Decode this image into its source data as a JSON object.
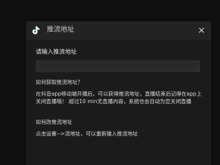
{
  "dialog": {
    "title": "推流地址",
    "app_icon": "tiktok-logo-icon",
    "close_icon": "close-icon",
    "colors": {
      "background": "#1b1b1b",
      "titlebar": "#232323",
      "input": "#2a2a2a",
      "text": "#dcdcdc"
    }
  },
  "form": {
    "label": "请输入推流地址",
    "input_value": "",
    "input_placeholder": ""
  },
  "help": {
    "q1": "如何获取推流地址？",
    "a1": "在抖音app移动端开播后，可以获得推流地址，直播结束后记得在app上关闭直播哦！ 超过10 min无直播内容，系统也会自动为您关闭直播",
    "q2": "如何改推流地址",
    "a2": "点击设置-->流地址，可以重新输入推流地址"
  }
}
